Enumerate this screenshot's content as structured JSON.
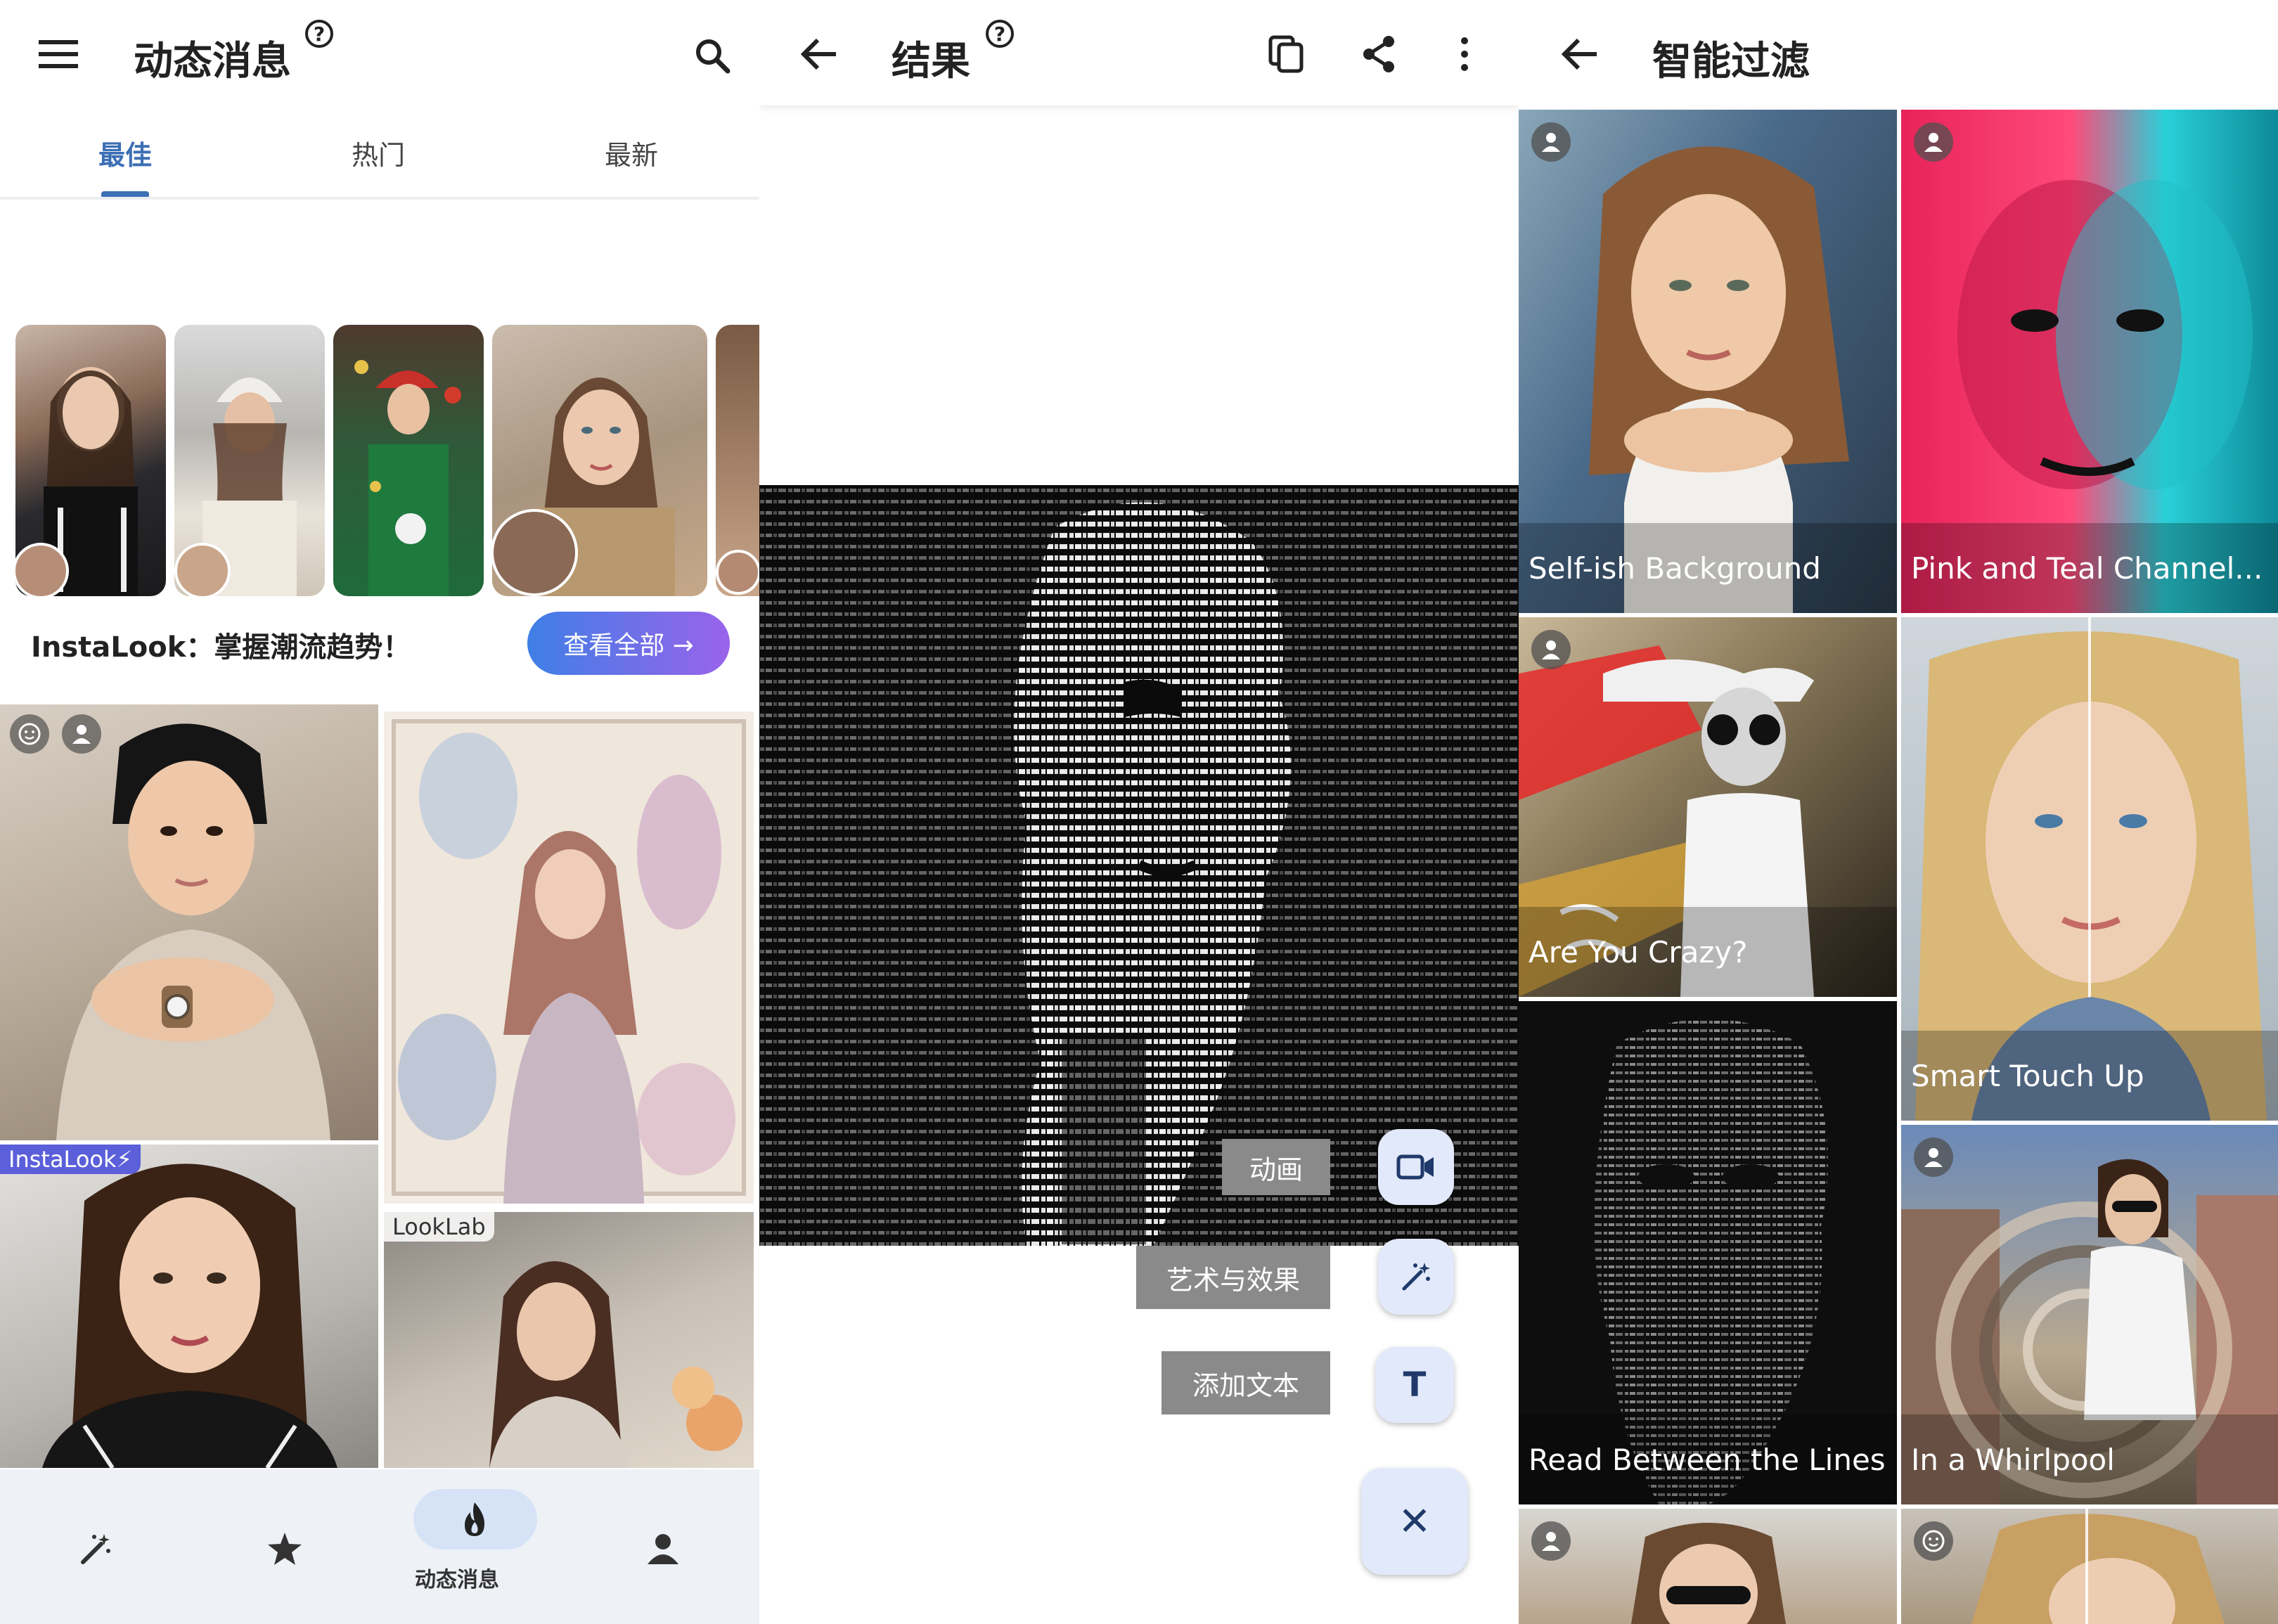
{
  "feed": {
    "title": "动态消息",
    "tabs": [
      "最佳",
      "热门",
      "最新"
    ],
    "promo_text": "InstaLook：掌握潮流趋势！",
    "view_all": "查看全部 →",
    "card_badges": [
      "InstaLook⚡",
      "LookLab"
    ],
    "nav_active_label": "动态消息",
    "colors": {
      "accent": "#3c6fb4",
      "gradient_start": "#3f7fe6",
      "gradient_end": "#9a63ea"
    }
  },
  "result": {
    "title": "结果",
    "fab_labels": [
      "动画",
      "艺术与效果",
      "添加文本"
    ],
    "text_fab_glyph": "T",
    "close_glyph": "✕"
  },
  "filters": {
    "title": "智能过滤",
    "tiles": [
      "Self-ish Background",
      "Pink and Teal Channel...",
      "Are You Crazy?",
      "Smart Touch Up",
      "Read Between the Lines",
      "In a Whirlpool"
    ]
  },
  "icons": [
    "menu-icon",
    "help-icon",
    "search-icon",
    "back-arrow-icon",
    "copy-icon",
    "share-icon",
    "more-vert-icon",
    "magic-wand-icon",
    "star-icon",
    "flame-icon",
    "person-icon",
    "video-camera-icon",
    "close-icon",
    "face-icon"
  ]
}
